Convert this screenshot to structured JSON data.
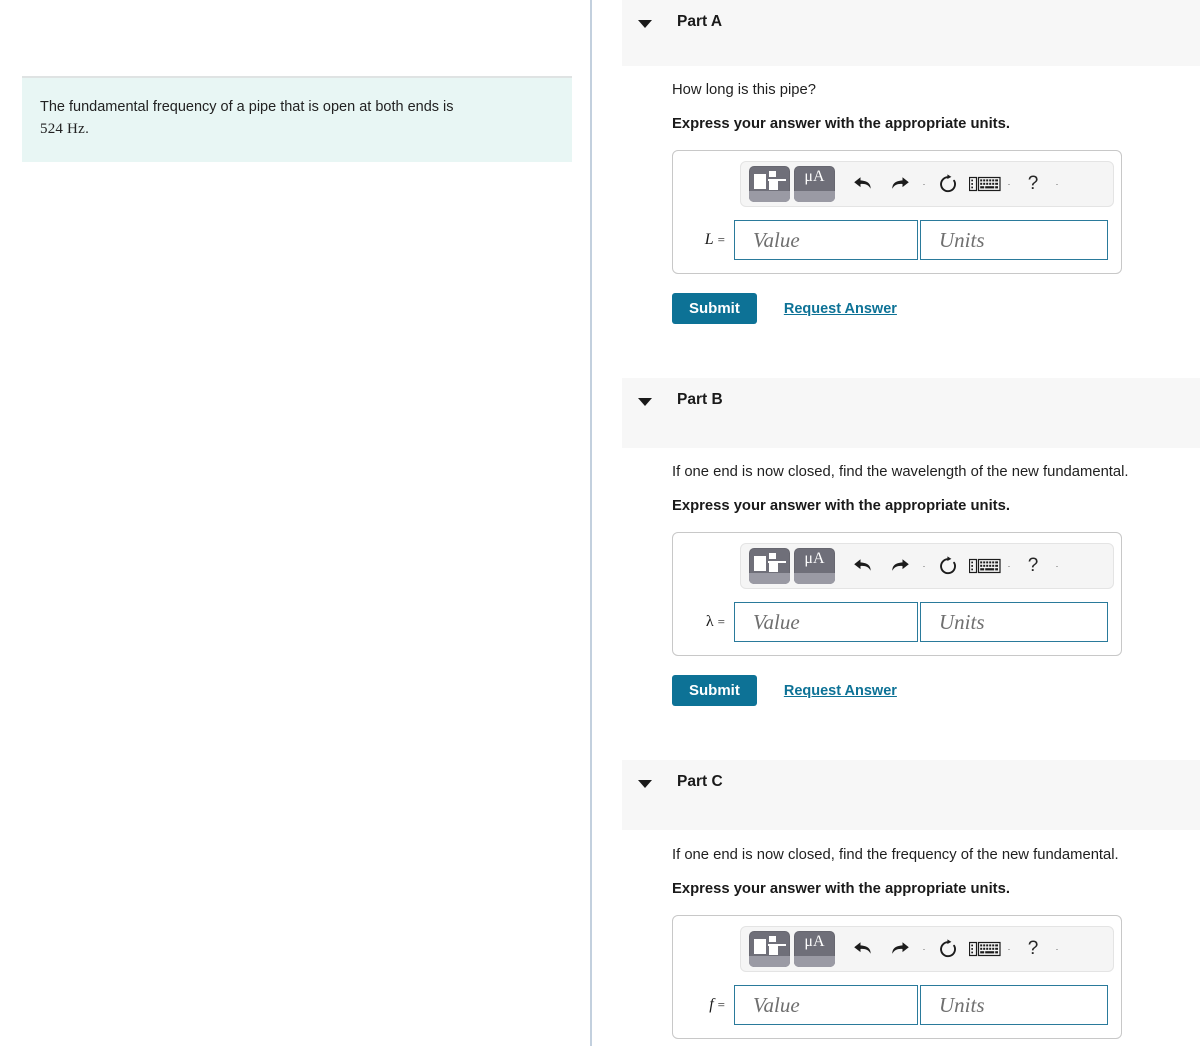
{
  "problem": {
    "statement_line1": "The fundamental frequency of a pipe that is open at both ends is",
    "statement_value": "524 Hz",
    "statement_period": "."
  },
  "colors": {
    "accent": "#0d7296",
    "problem_box_bg": "#e8f6f4",
    "part_header_bg": "#f7f7f7",
    "input_border": "#2a7a9b",
    "divider": "#c3d0de"
  },
  "toolbar": {
    "template_button_label": "template-picker",
    "units_button_label": "μA",
    "undo_label": "undo",
    "redo_label": "redo",
    "reset_label": "reset",
    "keyboard_label": "keyboard",
    "help_label": "?",
    "more_label": "·"
  },
  "common": {
    "instruction": "Express your answer with the appropriate units.",
    "value_placeholder": "Value",
    "units_placeholder": "Units",
    "submit_label": "Submit",
    "request_answer_label": "Request Answer",
    "equals": "="
  },
  "parts": [
    {
      "id": "part-a",
      "title": "Part A",
      "question": "How long is this pipe?",
      "variable": "L",
      "value": "",
      "units": ""
    },
    {
      "id": "part-b",
      "title": "Part B",
      "question": "If one end is now closed, find the wavelength of the new fundamental.",
      "variable": "λ",
      "value": "",
      "units": ""
    },
    {
      "id": "part-c",
      "title": "Part C",
      "question": "If one end is now closed, find the frequency of the new fundamental.",
      "variable": "f",
      "value": "",
      "units": ""
    }
  ]
}
